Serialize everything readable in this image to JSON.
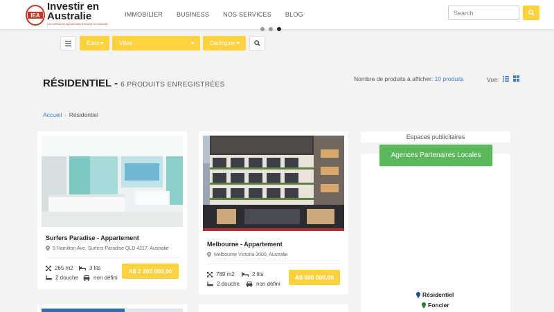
{
  "header": {
    "logo": {
      "line1": "Investir en",
      "line2": "Australie",
      "tagline": "Les meilleures opportunités d'investir en Australie",
      "badge": "IEA"
    },
    "nav": [
      "IMMOBILIER",
      "BUSINESS",
      "NOS SERVICES",
      "BLOG"
    ],
    "search_placeholder": "Search",
    "accent_color": "#fdd23e"
  },
  "filters": {
    "etats": "Etats",
    "villes": "Villes",
    "ville": "Darlington"
  },
  "page": {
    "title": "RÉSIDENTIEL",
    "subtitle": "6 PRODUITS ENREGISTRÉES",
    "per_page_label": "Nombre de produits à afficher:",
    "per_page_value": "10 produits",
    "view_label": "Vue:"
  },
  "breadcrumb": {
    "home": "Accueil",
    "current": "Résidentiel"
  },
  "products": [
    {
      "title": "Surfers Paradise - Appartement",
      "address": "9 Hamilton Ave, Surfers Paradise QLD 4217, Australie",
      "area": "265 m2",
      "beds": "3 lits",
      "baths": "2 douche",
      "parking": "non défini",
      "price": "A$ 2 265 000,00"
    },
    {
      "title": "Melbourne - Appartement",
      "address": "Melbourne Victoria 3000, Australie",
      "area": "789 m2",
      "beds": "2 lits",
      "baths": "2 douche",
      "parking": "non défini",
      "price": "A$ 600 000,00"
    }
  ],
  "sidebar": {
    "ads_title": "Espaces publicitaires",
    "agencies_button": "Agences Partenaires Locales",
    "legend": [
      {
        "label": "Résidentiel",
        "color": "#1f4e8c"
      },
      {
        "label": "Foncier",
        "color": "#2e7d32"
      }
    ]
  },
  "carousel": {
    "dots": 3,
    "active": 3
  }
}
